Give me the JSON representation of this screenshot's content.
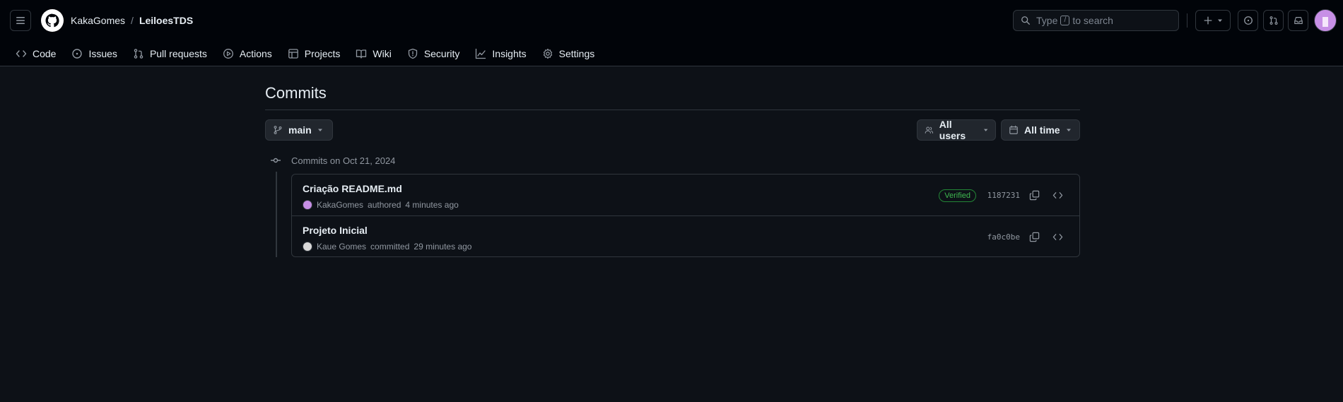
{
  "header": {
    "owner": "KakaGomes",
    "separator": "/",
    "repo": "LeiloesTDS",
    "search": {
      "prefix": "Type",
      "key": "/",
      "suffix": "to search"
    }
  },
  "repo_nav": [
    {
      "label": "Code",
      "icon": "code-icon"
    },
    {
      "label": "Issues",
      "icon": "issue-opened-icon"
    },
    {
      "label": "Pull requests",
      "icon": "git-pull-request-icon"
    },
    {
      "label": "Actions",
      "icon": "play-icon"
    },
    {
      "label": "Projects",
      "icon": "table-icon"
    },
    {
      "label": "Wiki",
      "icon": "book-icon"
    },
    {
      "label": "Security",
      "icon": "shield-icon"
    },
    {
      "label": "Insights",
      "icon": "graph-icon"
    },
    {
      "label": "Settings",
      "icon": "gear-icon"
    }
  ],
  "main": {
    "title": "Commits",
    "branch": "main",
    "users_filter": "All users",
    "time_filter": "All time",
    "group_heading": "Commits on Oct 21, 2024"
  },
  "commits": [
    {
      "message": "Criação README.md",
      "author": "KakaGomes",
      "action": "authored",
      "time": "4 minutes ago",
      "verified": "Verified",
      "sha": "1187231"
    },
    {
      "message": "Projeto Inicial",
      "author": "Kaue Gomes",
      "action": "committed",
      "time": "29 minutes ago",
      "verified": "",
      "sha": "fa0c0be"
    }
  ],
  "colors": {
    "background": "#0d1117",
    "header": "#010409",
    "border": "#30363d",
    "verified": "#3fb950"
  }
}
